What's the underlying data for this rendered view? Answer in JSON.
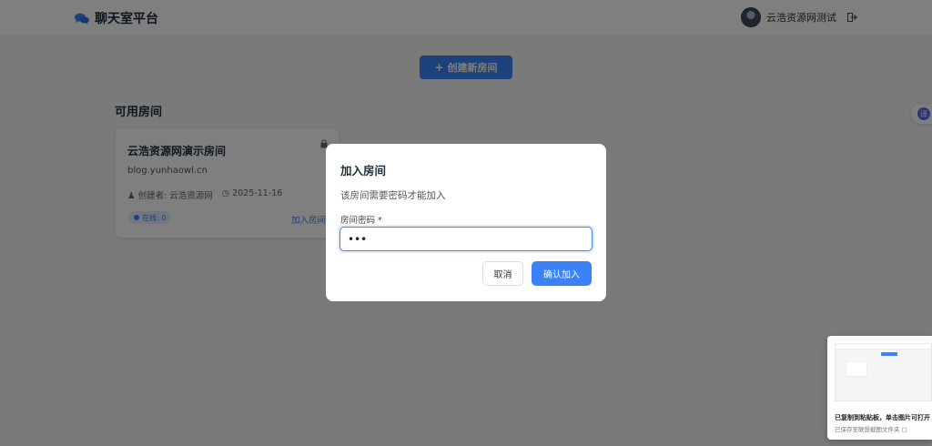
{
  "header": {
    "brand": "聊天室平台",
    "brand_icon": "comments-icon",
    "user_name": "云浩资源网测试",
    "logout_icon": "logout-icon"
  },
  "main": {
    "create_button": "创建新房间",
    "section_title": "可用房间",
    "rooms": [
      {
        "name": "云浩资源网演示房间",
        "description": "blog.yunhaowl.cn",
        "creator": "创建者: 云浩资源网",
        "date": "2025-11-16",
        "online": "在线: 0",
        "join_label": "加入房间"
      }
    ]
  },
  "modal": {
    "title": "加入房间",
    "description": "该房间需要密码才能加入",
    "field_label": "房间密码 *",
    "password_value": "•••",
    "cancel_label": "取消",
    "confirm_label": "确认加入"
  },
  "translate_float": {
    "icon_text": "译"
  },
  "notification": {
    "title": "已复制到粘贴板，单击图片可打开",
    "subtitle": "已保存至联想截图文件夹"
  },
  "colors": {
    "accent": "#3b82f6",
    "overlay": "rgba(0,0,0,0.5)",
    "background": "#f4f5f7"
  }
}
